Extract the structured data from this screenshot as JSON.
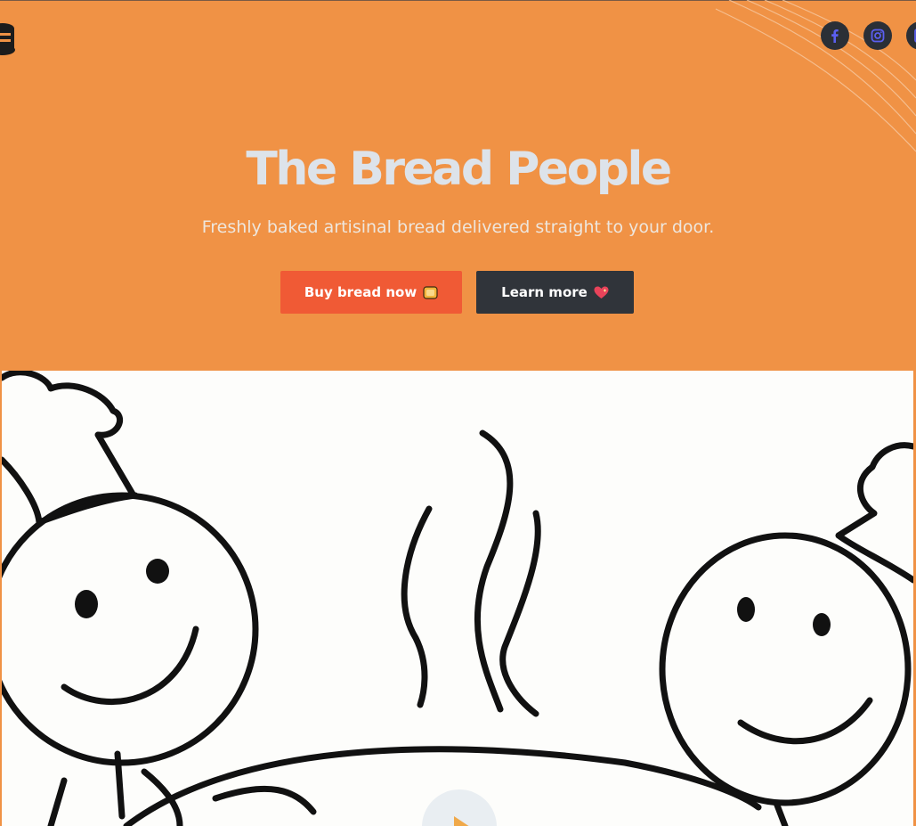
{
  "header": {
    "logo_icon": "bread-pot-logo-icon",
    "social": [
      {
        "name": "facebook",
        "icon": "facebook-icon",
        "glyph": "f"
      },
      {
        "name": "instagram",
        "icon": "instagram-icon",
        "glyph": ""
      },
      {
        "name": "third",
        "icon": "social-icon",
        "glyph": ""
      }
    ]
  },
  "hero": {
    "title": "The Bread People",
    "subtitle": "Freshly baked artisinal bread delivered straight to your door.",
    "buy_label": "Buy bread now",
    "learn_label": "Learn more"
  },
  "media": {
    "image_icon": "chef-doodle-illustration",
    "play_icon": "play-icon"
  },
  "colors": {
    "background": "#f09245",
    "title": "#dde3ea",
    "buy_button": "#f05a35",
    "learn_button": "#30343a",
    "social_bg": "#2b2f36",
    "social_glyph": "#5b5ff0"
  }
}
